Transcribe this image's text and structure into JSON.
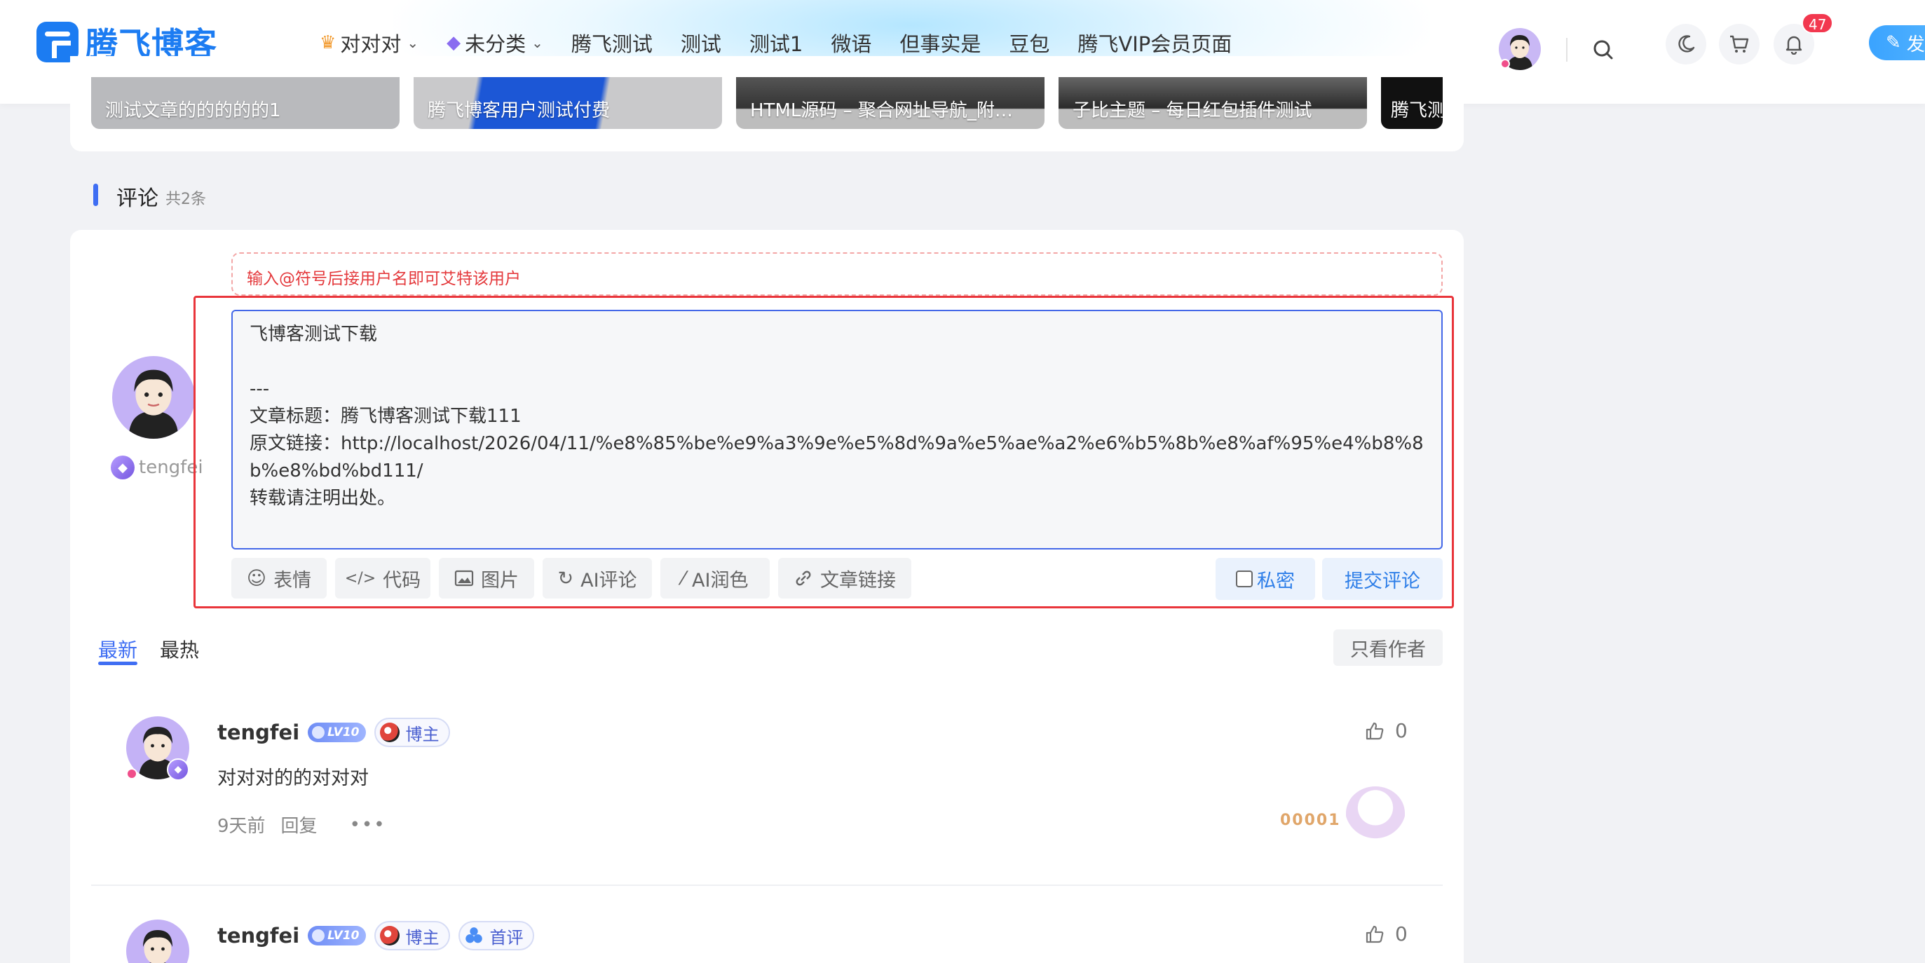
{
  "brand": {
    "name": "腾飞博客"
  },
  "nav": [
    {
      "label": "对对对",
      "icon": "crown-icon",
      "dropdown": true
    },
    {
      "label": "未分类",
      "icon": "gem-icon",
      "dropdown": true
    },
    {
      "label": "腾飞测试"
    },
    {
      "label": "测试"
    },
    {
      "label": "测试1"
    },
    {
      "label": "微语"
    },
    {
      "label": "但事实是"
    },
    {
      "label": "豆包"
    },
    {
      "label": "腾飞VIP会员页面"
    }
  ],
  "header": {
    "notification_count": "47",
    "post_button": "发"
  },
  "related": [
    {
      "title": "测试文章的的的的的1"
    },
    {
      "title": "腾飞博客用户测试付费"
    },
    {
      "title": "HTML源码 – 聚合网址导航_附…"
    },
    {
      "title": "子比主题 – 每日红包插件测试"
    },
    {
      "title": "腾飞测"
    }
  ],
  "comments_section": {
    "title": "评论",
    "count": "共2条",
    "mention_hint": "输入@符号后接用户名即可艾特该用户",
    "textarea_value": "飞博客测试下载\n\n---\n文章标题：腾飞博客测试下载111\n原文链接：http://localhost/2026/04/11/%e8%85%be%e9%a3%9e%e5%8d%9a%e5%ae%a2%e6%b5%8b%e8%af%95%e4%b8%8b%e8%bd%bd111/\n转载请注明出处。",
    "current_user": "tengfei",
    "tools": [
      {
        "label": "表情",
        "icon": "smile-icon"
      },
      {
        "label": "代码",
        "icon": "code-icon"
      },
      {
        "label": "图片",
        "icon": "image-icon"
      },
      {
        "label": "AI评论",
        "icon": "refresh-icon"
      },
      {
        "label": "AI润色",
        "icon": "magic-wand-icon"
      },
      {
        "label": "文章链接",
        "icon": "link-icon"
      }
    ],
    "private_label": "私密",
    "submit_label": "提交评论",
    "tabs": {
      "latest": "最新",
      "hottest": "最热"
    },
    "author_only": "只看作者"
  },
  "comments": [
    {
      "author": "tengfei",
      "level": "LV10",
      "tags": [
        "博主"
      ],
      "text": "对对对的的对对对",
      "time": "9天前",
      "reply": "回复",
      "more": "•••",
      "likes": "0",
      "decoration": "00001"
    },
    {
      "author": "tengfei",
      "level": "LV10",
      "tags": [
        "博主",
        "首评"
      ],
      "likes": "0"
    }
  ],
  "colors": {
    "accent": "#3f6ef3",
    "brand": "#1c7cf2",
    "highlight_frame": "#e9353b",
    "badge": "#f2384f"
  }
}
